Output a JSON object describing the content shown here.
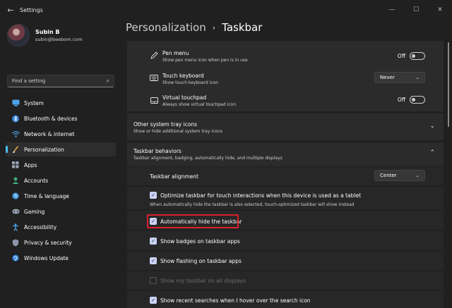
{
  "window": {
    "title": "Settings",
    "controls": {
      "minimize": "—",
      "maximize": "☐",
      "close": "✕"
    }
  },
  "profile": {
    "name": "Subin B",
    "email": "subin@beebom.com"
  },
  "search": {
    "placeholder": "Find a setting"
  },
  "nav": [
    {
      "label": "System",
      "icon": "monitor-icon",
      "active": false
    },
    {
      "label": "Bluetooth & devices",
      "icon": "bluetooth-icon",
      "active": false
    },
    {
      "label": "Network & internet",
      "icon": "wifi-icon",
      "active": false
    },
    {
      "label": "Personalization",
      "icon": "brush-icon",
      "active": true
    },
    {
      "label": "Apps",
      "icon": "apps-icon",
      "active": false
    },
    {
      "label": "Accounts",
      "icon": "person-icon",
      "active": false
    },
    {
      "label": "Time & language",
      "icon": "globe-clock-icon",
      "active": false
    },
    {
      "label": "Gaming",
      "icon": "gamepad-icon",
      "active": false
    },
    {
      "label": "Accessibility",
      "icon": "accessibility-icon",
      "active": false
    },
    {
      "label": "Privacy & security",
      "icon": "shield-icon",
      "active": false
    },
    {
      "label": "Windows Update",
      "icon": "update-icon",
      "active": false
    }
  ],
  "breadcrumb": {
    "parent": "Personalization",
    "separator": "›",
    "current": "Taskbar"
  },
  "taskbar_items": {
    "pen_menu": {
      "title": "Pen menu",
      "desc": "Show pen menu icon when pen is in use",
      "state": "Off"
    },
    "touch_keyboard": {
      "title": "Touch keyboard",
      "desc": "Show touch keyboard icon",
      "value": "Never"
    },
    "virtual_touchpad": {
      "title": "Virtual touchpad",
      "desc": "Always show virtual touchpad icon",
      "state": "Off"
    }
  },
  "other_tray": {
    "title": "Other system tray icons",
    "desc": "Show or hide additional system tray icons"
  },
  "behaviors": {
    "title": "Taskbar behaviors",
    "desc": "Taskbar alignment, badging, automatically hide, and multiple displays",
    "alignment_label": "Taskbar alignment",
    "alignment_value": "Center",
    "optimize_label": "Optimize taskbar for touch interactions when this device is used as a tablet",
    "optimize_note": "When automatically hide the taskbar is also selected, touch-optimized taskbar will show instead",
    "autohide_label": "Automatically hide the taskbar",
    "badges_label": "Show badges on taskbar apps",
    "flashing_label": "Show flashing on taskbar apps",
    "all_displays_label": "Show my taskbar on all displays",
    "recent_searches_label": "Show recent searches when I hover over the search icon"
  },
  "colors": {
    "accent": "#4cc2ff",
    "highlight": "#d9212b",
    "checkbox": "#c9d3f5"
  }
}
